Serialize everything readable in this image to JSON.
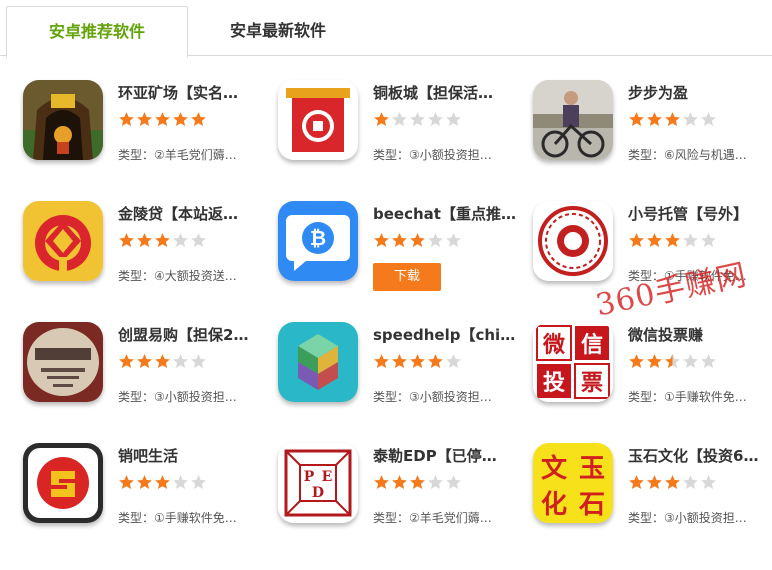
{
  "tabs": [
    {
      "label": "安卓推荐软件",
      "active": true
    },
    {
      "label": "安卓最新软件",
      "active": false
    }
  ],
  "colors": {
    "active_tab": "#62a30a",
    "star_on": "#f57a1c",
    "star_off": "#d8d8d8",
    "download": "#f57a1c",
    "watermark": "#d62020"
  },
  "apps": [
    {
      "name": "环亚矿场【实名…",
      "rating": 5,
      "type": "类型：②羊毛党们薅…",
      "icon": "mine-cart-icon"
    },
    {
      "name": "铜板城【担保活…",
      "rating": 1,
      "type": "类型：③小额投资担…",
      "icon": "castle-icon"
    },
    {
      "name": "步步为盈",
      "rating": 3,
      "type": "类型：⑥风险与机遇…",
      "icon": "cyclist-photo-icon"
    },
    {
      "name": "金陵贷【本站返…",
      "rating": 3,
      "type": "类型：④大额投资送…",
      "icon": "jinling-logo-icon"
    },
    {
      "name": "beechat【重点推…",
      "rating": 3,
      "download": "下载",
      "icon": "bitcoin-chat-icon"
    },
    {
      "name": "小号托管【号外】",
      "rating": 3,
      "type": "类型：①手赚软件免…",
      "icon": "red-seal-icon"
    },
    {
      "name": "创盟易购【担保2…",
      "rating": 3,
      "type": "类型：③小额投资担…",
      "icon": "chuangmeng-photo-icon"
    },
    {
      "name": "speedhelp【chi…",
      "rating": 4,
      "type": "类型：③小额投资担…",
      "icon": "prism-logo-icon"
    },
    {
      "name": "微信投票赚",
      "rating": 2.5,
      "type": "类型：①手赚软件免…",
      "icon": "wechat-vote-icon",
      "icon_text": [
        "微",
        "信",
        "投",
        "票"
      ]
    },
    {
      "name": "销吧生活",
      "rating": 3,
      "type": "类型：①手赚软件免…",
      "icon": "xiaoba-logo-icon"
    },
    {
      "name": "泰勒EDP【已停…",
      "rating": 3,
      "type": "类型：②羊毛党们薅…",
      "icon": "ped-cube-icon",
      "icon_text": [
        "P",
        "E",
        "D"
      ]
    },
    {
      "name": "玉石文化【投资6…",
      "rating": 3,
      "type": "类型：③小额投资担…",
      "icon": "jade-culture-icon",
      "icon_text": [
        "文",
        "玉",
        "化",
        "石"
      ]
    }
  ],
  "watermark": "360手赚网"
}
